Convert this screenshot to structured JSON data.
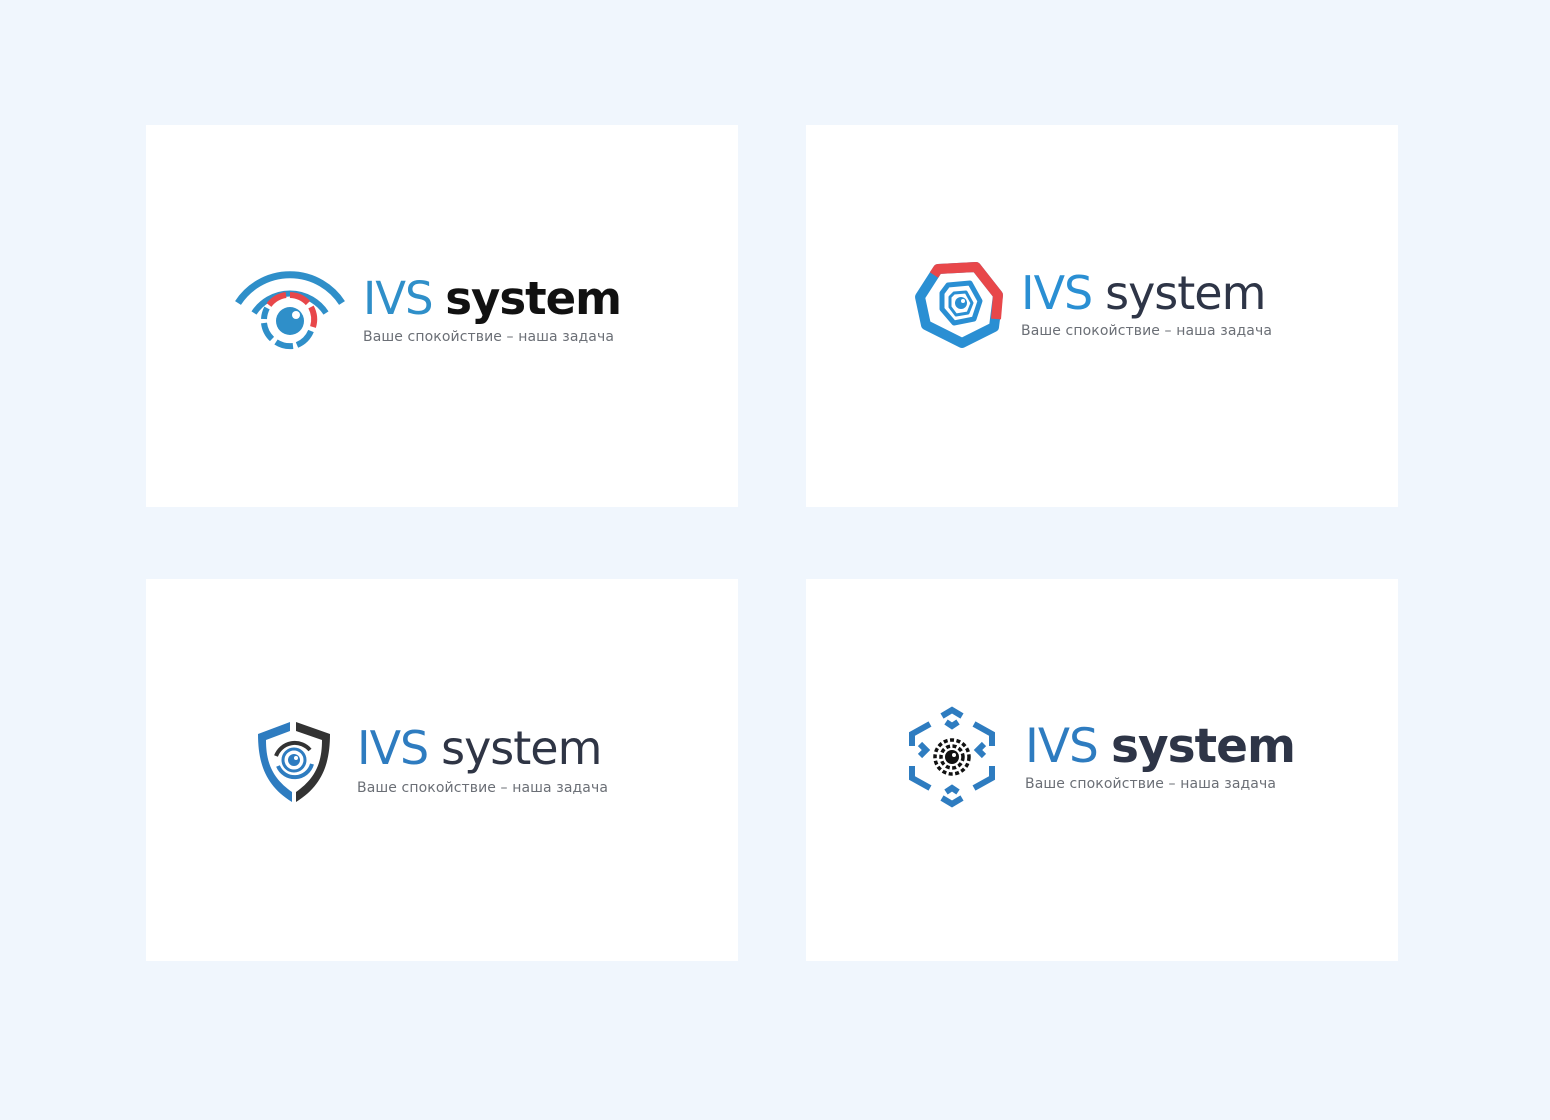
{
  "logos": [
    {
      "brand_part_1": "IVS",
      "brand_part_2": "system",
      "tagline": "Ваше спокойствие – наша задача",
      "icon": "eye-signal-icon",
      "colors": {
        "primary": "#2f8fc9",
        "accent": "#e8474a",
        "text": "#111111"
      }
    },
    {
      "brand_part_1": "IVS",
      "brand_part_2": "system",
      "tagline": "Ваше спокойствие – наша задача",
      "icon": "hexagon-lens-icon",
      "colors": {
        "primary": "#2a8fd3",
        "accent": "#e8474a",
        "text": "#2e3547"
      }
    },
    {
      "brand_part_1": "IVS",
      "brand_part_2": "system",
      "tagline": "Ваше спокойствие – наша задача",
      "icon": "shield-eye-icon",
      "colors": {
        "primary": "#2e7cc0",
        "accent": "#333333",
        "text": "#2f3545"
      }
    },
    {
      "brand_part_1": "IVS",
      "brand_part_2": "system",
      "tagline": "Ваше спокойствие – наша задача",
      "icon": "hexagon-aperture-icon",
      "colors": {
        "primary": "#2e7cc0",
        "accent": "#111111",
        "text": "#2e3547"
      }
    }
  ],
  "background": "#f0f6fd",
  "card_background": "#ffffff"
}
